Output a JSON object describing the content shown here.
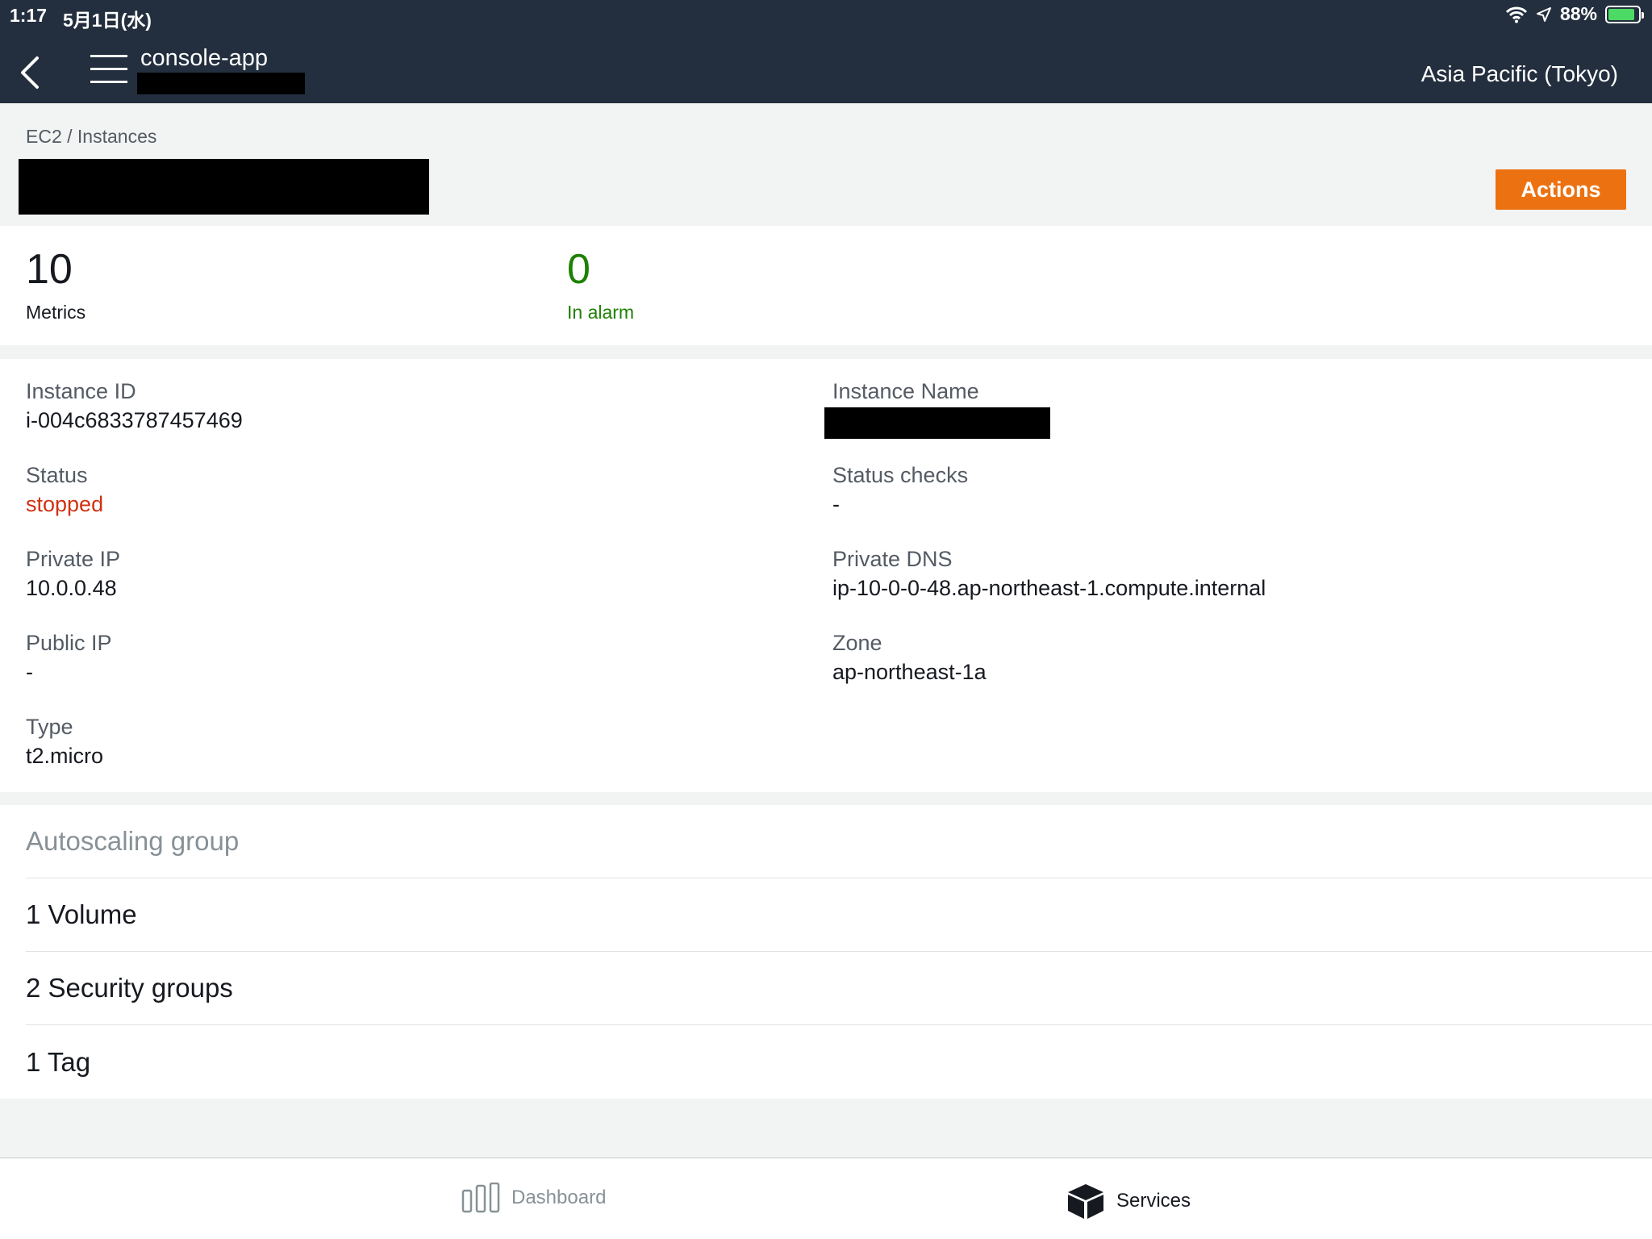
{
  "status_bar": {
    "time": "1:17",
    "date": "5月1日(水)",
    "battery": "88%",
    "battery_level": 0.88
  },
  "nav": {
    "app_title": "console-app",
    "region": "Asia Pacific (Tokyo)"
  },
  "header": {
    "breadcrumb": "EC2 / Instances",
    "actions_label": "Actions"
  },
  "metrics": {
    "count_value": "10",
    "count_label": "Metrics",
    "alarm_value": "0",
    "alarm_label": "In alarm"
  },
  "details": {
    "instance_id_label": "Instance ID",
    "instance_id": "i-004c6833787457469",
    "instance_name_label": "Instance Name",
    "status_label": "Status",
    "status": "stopped",
    "status_checks_label": "Status checks",
    "status_checks": "-",
    "private_ip_label": "Private IP",
    "private_ip": "10.0.0.48",
    "private_dns_label": "Private DNS",
    "private_dns": "ip-10-0-0-48.ap-northeast-1.compute.internal",
    "public_ip_label": "Public IP",
    "public_ip": "-",
    "zone_label": "Zone",
    "zone": "ap-northeast-1a",
    "type_label": "Type",
    "type": "t2.micro"
  },
  "sections": {
    "autoscaling": "Autoscaling group",
    "volume": "1 Volume",
    "security_groups": "2 Security groups",
    "tag": "1 Tag"
  },
  "tabs": {
    "dashboard": "Dashboard",
    "services": "Services"
  },
  "colors": {
    "nav_bg": "#232f3e",
    "accent_orange": "#ec7211",
    "ok_green": "#1d8102",
    "stopped_red": "#d13212"
  }
}
